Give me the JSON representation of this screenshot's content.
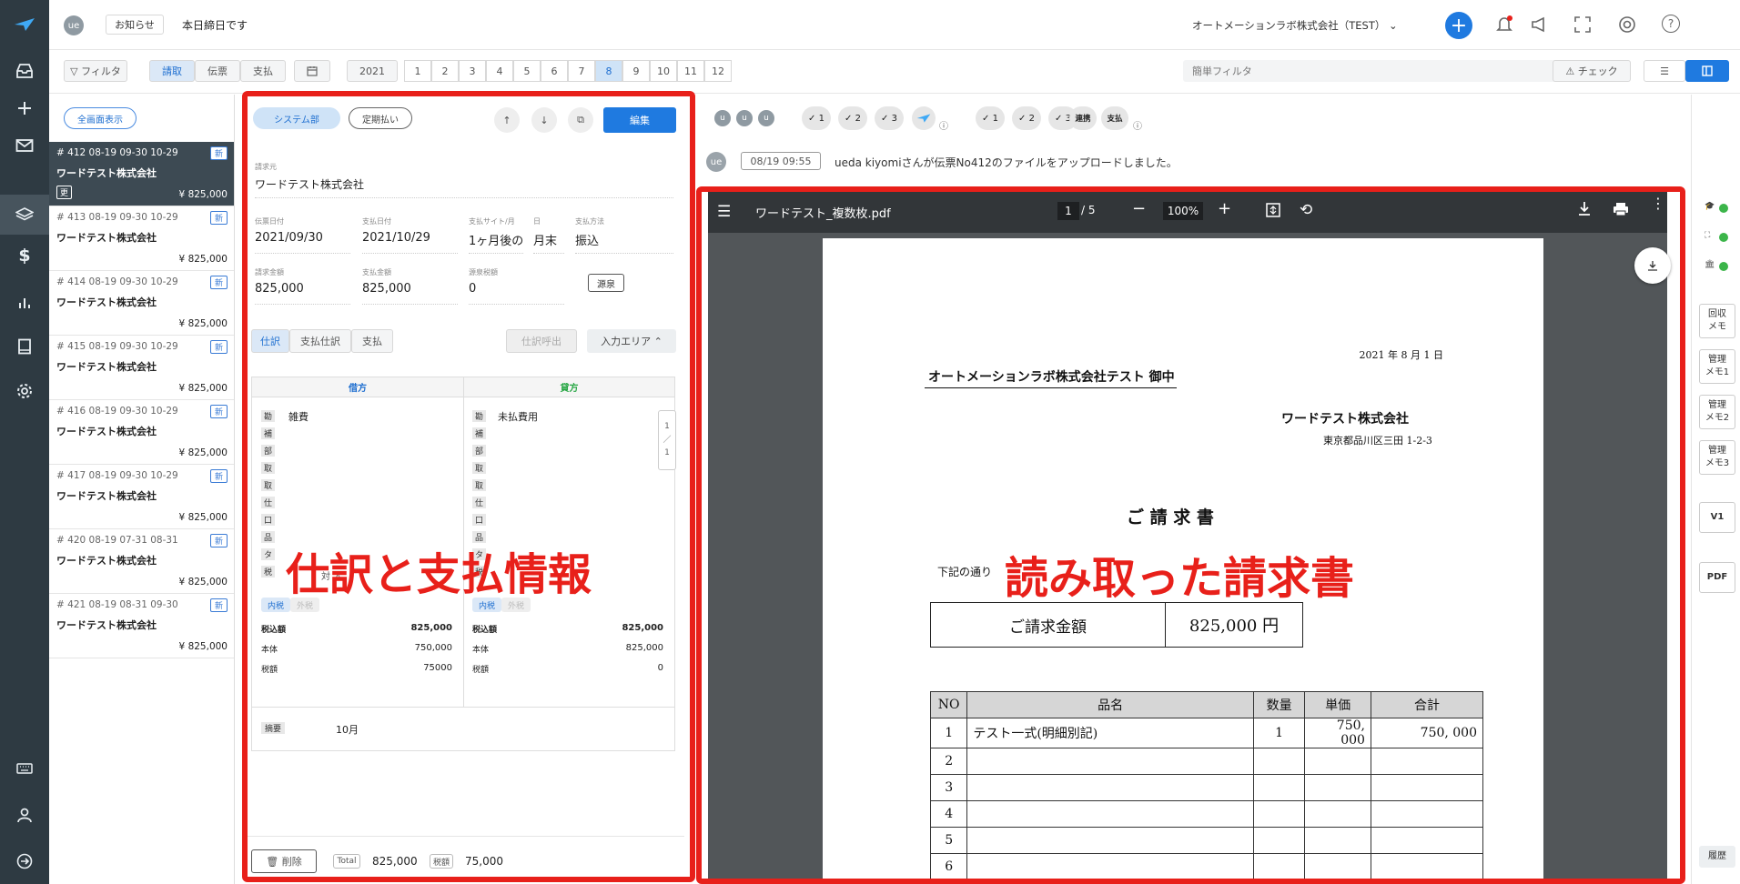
{
  "topbar": {
    "user_initials": "ue",
    "notice_label": "お知らせ",
    "notice_text": "本日締日です",
    "company": "オートメーションラボ株式会社（TEST）",
    "help": "?"
  },
  "filterbar": {
    "filter_label": "フィルタ",
    "doc_tabs": [
      "請取",
      "伝票",
      "支払"
    ],
    "year": "2021",
    "months": [
      "1",
      "2",
      "3",
      "4",
      "5",
      "6",
      "7",
      "8",
      "9",
      "10",
      "11",
      "12"
    ],
    "active_month": "8",
    "search_placeholder": "簡単フィルタ",
    "check_label": "チェック"
  },
  "list": {
    "full_view_label": "全画面表示",
    "items": [
      {
        "meta": "# 412  08-19  09-30  10-29",
        "badge": "新",
        "company": "ワードテスト株式会社",
        "amount": "¥ 825,000",
        "tag": "更"
      },
      {
        "meta": "# 413  08-19  09-30  10-29",
        "badge": "新",
        "company": "ワードテスト株式会社",
        "amount": "¥ 825,000"
      },
      {
        "meta": "# 414  08-19  09-30  10-29",
        "badge": "新",
        "company": "ワードテスト株式会社",
        "amount": "¥ 825,000"
      },
      {
        "meta": "# 415  08-19  09-30  10-29",
        "badge": "新",
        "company": "ワードテスト株式会社",
        "amount": "¥ 825,000"
      },
      {
        "meta": "# 416  08-19  09-30  10-29",
        "badge": "新",
        "company": "ワードテスト株式会社",
        "amount": "¥ 825,000"
      },
      {
        "meta": "# 417  08-19  09-30  10-29",
        "badge": "新",
        "company": "ワードテスト株式会社",
        "amount": "¥ 825,000"
      },
      {
        "meta": "# 420  08-19  07-31  08-31",
        "badge": "新",
        "company": "ワードテスト株式会社",
        "amount": "¥ 825,000"
      },
      {
        "meta": "# 421  08-19  08-31  09-30",
        "badge": "新",
        "company": "ワードテスト株式会社",
        "amount": "¥ 825,000"
      }
    ]
  },
  "detail": {
    "dept": "システム部",
    "regular": "定期払い",
    "edit": "編集",
    "billing_label": "請求元",
    "billing_value": "ワードテスト株式会社",
    "fields": {
      "voucher_date_label": "伝票日付",
      "voucher_date": "2021/09/30",
      "pay_date_label": "支払日付",
      "pay_date": "2021/10/29",
      "site_label": "支払サイト/月",
      "site": "1ヶ月後の",
      "day_label": "日",
      "day": "月末",
      "method_label": "支払方法",
      "method": "振込",
      "invoice_amt_label": "請求金額",
      "invoice_amt": "825,000",
      "pay_amt_label": "支払金額",
      "pay_amt": "825,000",
      "withholding_label": "源泉税額",
      "withholding": "0",
      "withholding_btn": "源泉"
    },
    "tabs": [
      "仕訳",
      "支払仕訳",
      "支払"
    ],
    "journal_out": "仕訳呼出",
    "input_area": "入力エリア",
    "debit_header": "借方",
    "credit_header": "貸方",
    "row_labels": [
      "勘",
      "補",
      "部",
      "取",
      "取",
      "仕",
      "口",
      "品",
      "タ",
      "税"
    ],
    "debit_account": "雑費",
    "credit_account": "未払費用",
    "tax_partial": "対 入",
    "tax_in": "内税",
    "tax_out": "外税",
    "pager": [
      "1",
      "／",
      "1"
    ],
    "debit_totals": {
      "incl_label": "税込額",
      "incl": "825,000",
      "body_label": "本体",
      "body": "750,000",
      "tax_label": "税額",
      "tax": "75000"
    },
    "credit_totals": {
      "incl_label": "税込額",
      "incl": "825,000",
      "body_label": "本体",
      "body": "825,000",
      "tax_label": "税額",
      "tax": "0"
    },
    "summary_label": "摘要",
    "summary_value": "10月",
    "delete": "削除",
    "total_label": "Total",
    "total_value": "825,000",
    "tax_label": "税額",
    "tax_value": "75,000"
  },
  "status": {
    "initials": [
      "u",
      "u",
      "u"
    ],
    "checks": [
      "1",
      "2",
      "3"
    ],
    "checks2": [
      "1",
      "2",
      "3"
    ],
    "link": "連携",
    "pay": "支払"
  },
  "log": {
    "initials": "ue",
    "time": "08/19 09:55",
    "message": "ueda kiyomiさんが伝票No412のファイルをアップロードしました。"
  },
  "pdf": {
    "filename": "ワードテスト_複数枚.pdf",
    "page": "1",
    "pages": "/ 5",
    "zoom": "100%",
    "date": "2021 年 8 月 1 日",
    "addressee": "オートメーションラボ株式会社テスト  御中",
    "issuer": "ワードテスト株式会社",
    "address": "東京都品川区三田 1-2-3",
    "title": "ご 請 求 書",
    "intro": "下記の通り",
    "amount_label": "ご請求金額",
    "amount_value": "825,000 円",
    "table_headers": [
      "NO",
      "品名",
      "数量",
      "単価",
      "合計"
    ],
    "rows": [
      [
        "1",
        "テスト一式(明細別記)",
        "1",
        "750, 000",
        "750, 000"
      ],
      [
        "2",
        "",
        "",
        "",
        ""
      ],
      [
        "3",
        "",
        "",
        "",
        ""
      ],
      [
        "4",
        "",
        "",
        "",
        ""
      ],
      [
        "5",
        "",
        "",
        "",
        ""
      ],
      [
        "6",
        "",
        "",
        "",
        ""
      ]
    ]
  },
  "right_side": {
    "memos": [
      [
        "回収",
        "メモ"
      ],
      [
        "管理",
        "メモ1"
      ],
      [
        "管理",
        "メモ2"
      ],
      [
        "管理",
        "メモ3"
      ]
    ],
    "v1": "V1",
    "pdf": "PDF",
    "history": "履歴"
  },
  "annotations": {
    "left": "仕訳と支払情報",
    "right": "読み取った請求書"
  },
  "colors": {
    "rail": "#2e3a42",
    "accent": "#1f7ae0",
    "annotation": "#e8201a",
    "pdf_toolbar": "#323639",
    "pdf_bg": "#525659"
  }
}
